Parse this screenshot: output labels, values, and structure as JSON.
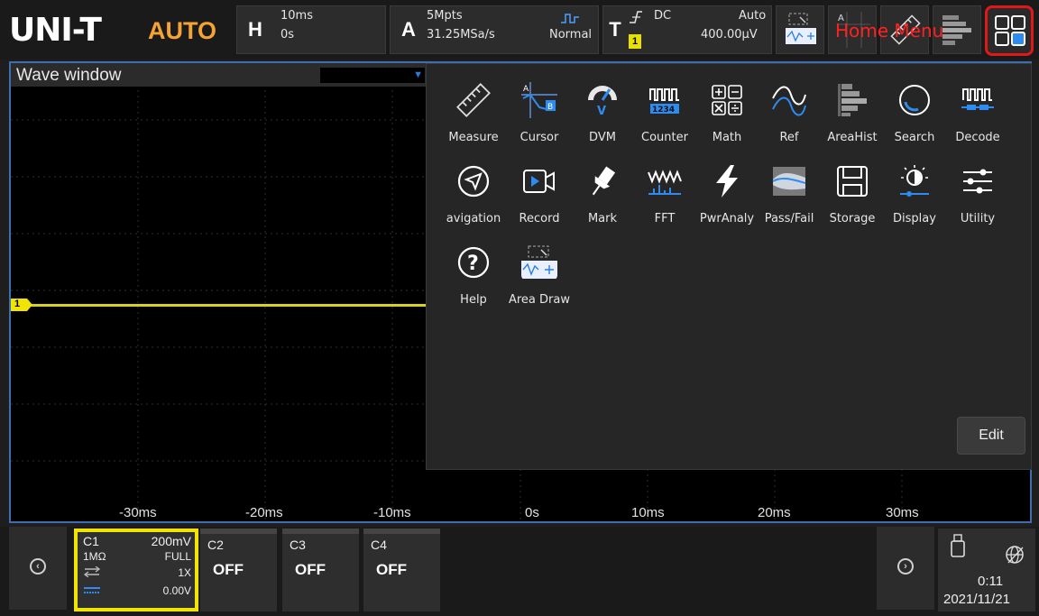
{
  "topbar": {
    "logo": "UNI-T",
    "mode": "AUTO",
    "horizontal": {
      "letter": "H",
      "timebase": "10ms",
      "offset": "0s"
    },
    "acquire": {
      "letter": "A",
      "depth": "5Mpts",
      "rate": "31.25MSa/s",
      "mode": "Normal"
    },
    "trigger": {
      "letter": "T",
      "coupling": "DC",
      "sweep": "Auto",
      "source": "1",
      "level": "400.00µV"
    },
    "home_menu_label": "Home Menu"
  },
  "wave": {
    "title": "Wave window",
    "xticks": [
      "-30ms",
      "-20ms",
      "-10ms",
      "0s",
      "10ms",
      "20ms",
      "30ms"
    ],
    "channel_marker": "1"
  },
  "menu": {
    "items": [
      {
        "label": "Measure",
        "icon": "measure-icon"
      },
      {
        "label": "Cursor",
        "icon": "cursor-icon"
      },
      {
        "label": "DVM",
        "icon": "dvm-icon"
      },
      {
        "label": "Counter",
        "icon": "counter-icon"
      },
      {
        "label": "Math",
        "icon": "math-icon"
      },
      {
        "label": "Ref",
        "icon": "ref-icon"
      },
      {
        "label": "AreaHist",
        "icon": "areahist-icon"
      },
      {
        "label": "Search",
        "icon": "search-icon"
      },
      {
        "label": "Decode",
        "icon": "decode-icon"
      },
      {
        "label": "avigation",
        "icon": "navigation-icon"
      },
      {
        "label": "Record",
        "icon": "record-icon"
      },
      {
        "label": "Mark",
        "icon": "mark-icon"
      },
      {
        "label": "FFT",
        "icon": "fft-icon"
      },
      {
        "label": "PwrAnaly",
        "icon": "power-analysis-icon"
      },
      {
        "label": "Pass/Fail",
        "icon": "pass-fail-icon"
      },
      {
        "label": "Storage",
        "icon": "storage-icon"
      },
      {
        "label": "Display",
        "icon": "display-icon"
      },
      {
        "label": "Utility",
        "icon": "utility-icon"
      },
      {
        "label": "Help",
        "icon": "help-icon"
      },
      {
        "label": "Area Draw",
        "icon": "area-draw-icon"
      }
    ],
    "edit_label": "Edit"
  },
  "bottom": {
    "c1": {
      "name": "C1",
      "scale": "200mV",
      "impedance": "1MΩ",
      "bandwidth": "FULL",
      "probe": "1X",
      "offset": "0.00V"
    },
    "c2": {
      "name": "C2",
      "state": "OFF"
    },
    "c3": {
      "name": "C3",
      "state": "OFF"
    },
    "c4": {
      "name": "C4",
      "state": "OFF"
    },
    "time": "0:11",
    "date": "2021/11/21"
  },
  "colors": {
    "accent_red": "#e01818",
    "channel1": "#f0e400",
    "auto_orange": "#f7a234",
    "window_border": "#3d6fb0"
  }
}
